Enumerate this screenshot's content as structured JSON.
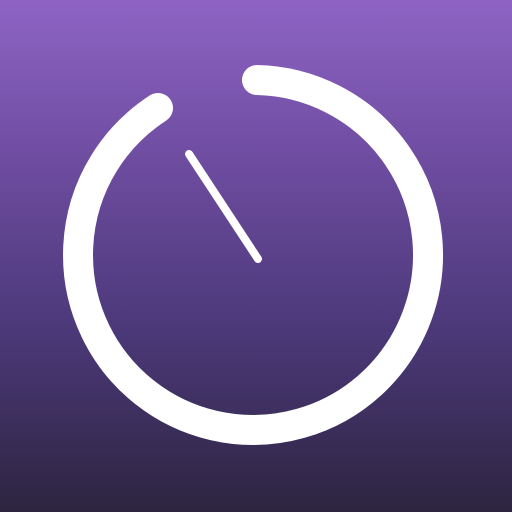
{
  "app_icon": {
    "icon": "timer-icon",
    "colors": {
      "background_top": "#8e63c4",
      "background_bottom": "#2d2540",
      "stroke": "#ffffff"
    }
  }
}
